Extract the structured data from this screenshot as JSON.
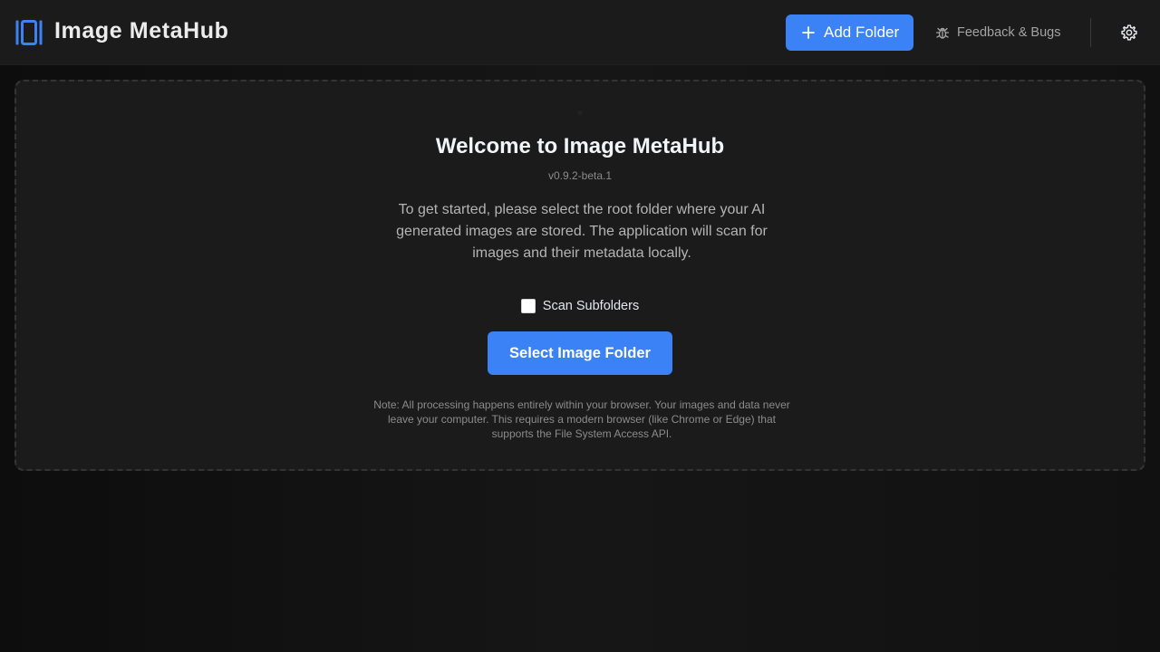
{
  "header": {
    "app_title": "Image MetaHub",
    "add_folder_label": "Add Folder",
    "feedback_label": "Feedback & Bugs",
    "icons": {
      "logo": "metahub-logo-icon",
      "add": "plus-icon",
      "feedback": "bug-icon",
      "settings": "gear-icon"
    }
  },
  "welcome": {
    "title": "Welcome to Image MetaHub",
    "version": "v0.9.2-beta.1",
    "intro": "To get started, please select the root folder where your AI generated images are stored. The application will scan for images and their metadata locally.",
    "scan_subfolders_label": "Scan Subfolders",
    "scan_subfolders_checked": false,
    "select_button_label": "Select Image Folder",
    "note": "Note: All processing happens entirely within your browser. Your images and data never leave your computer. This requires a modern browser (like Chrome or Edge) that supports the File System Access API."
  },
  "colors": {
    "accent": "#3b82f6",
    "background": "#141414",
    "header_background": "#1b1b1b"
  }
}
